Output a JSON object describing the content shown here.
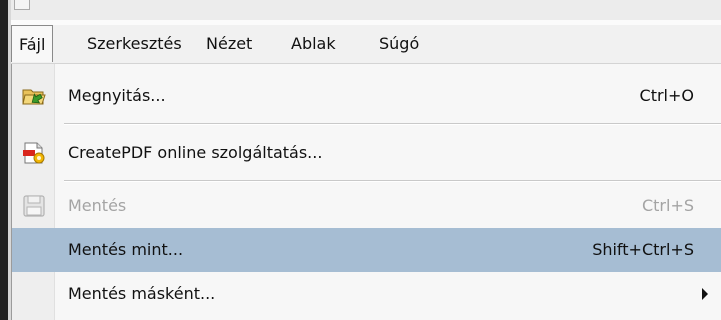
{
  "menubar": {
    "items": [
      {
        "label": "Fájl",
        "active": true
      },
      {
        "label": "Szerkesztés"
      },
      {
        "label": "Nézet"
      },
      {
        "label": "Ablak"
      },
      {
        "label": "Súgó"
      }
    ]
  },
  "dropdown": {
    "items": [
      {
        "label": "Megnyitás...",
        "shortcut": "Ctrl+O",
        "icon": "open-folder-icon"
      },
      {
        "label": "CreatePDF online szolgáltatás...",
        "shortcut": "",
        "icon": "createpdf-icon"
      },
      {
        "label": "Mentés",
        "shortcut": "Ctrl+S",
        "icon": "save-disk-icon",
        "disabled": true
      },
      {
        "label": "Mentés mint...",
        "shortcut": "Shift+Ctrl+S",
        "highlighted": true
      },
      {
        "label": "Mentés másként...",
        "shortcut": "",
        "submenu": true
      }
    ]
  },
  "colors": {
    "highlight": "#a6bdd3",
    "disabled_text": "#a4a4a4",
    "menu_bg": "#f7f7f7"
  }
}
